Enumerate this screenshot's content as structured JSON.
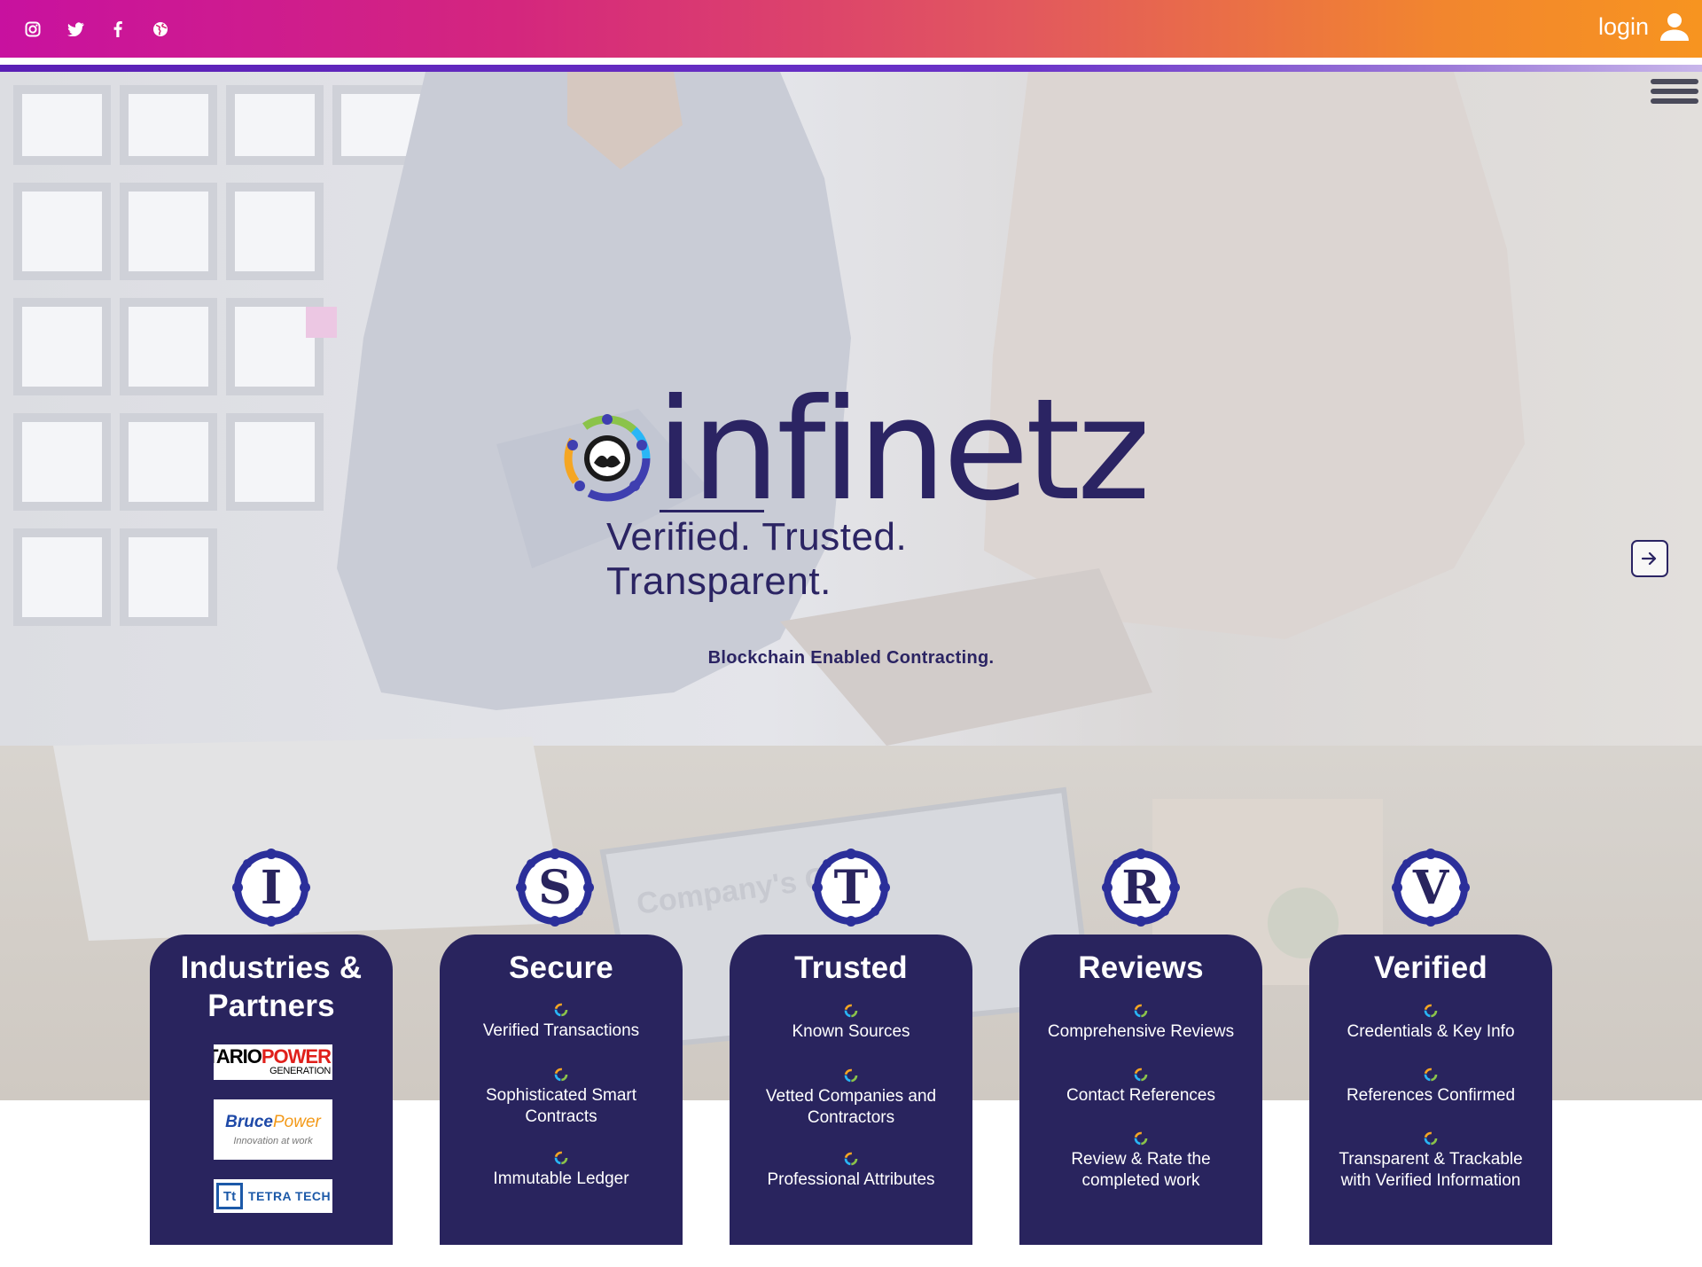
{
  "topbar": {
    "social": [
      "instagram-icon",
      "twitter-icon",
      "facebook-icon",
      "globe-icon"
    ],
    "login_label": "login"
  },
  "hero": {
    "brand_name": "infinetz",
    "tagline": "Verified. Trusted. Transparent.",
    "subtagline": "Blockchain Enabled Contracting."
  },
  "cards": [
    {
      "letter": "I",
      "title_line1": "Industries &",
      "title_line2": "Partners",
      "partners": [
        {
          "name_a": "ONTARIO",
          "name_b": "POWER",
          "name_c": "GENERATION"
        },
        {
          "name_a": "Bruce",
          "name_b": "Power",
          "name_c": "Innovation at work"
        },
        {
          "name_a": "Tt",
          "name_b": "TETRA TECH"
        }
      ]
    },
    {
      "letter": "S",
      "title": "Secure",
      "items": [
        {
          "line1": "Verified Transactions",
          "line2": ""
        },
        {
          "line1": "Sophisticated Smart",
          "line2": "Contracts"
        },
        {
          "line1": "Immutable Ledger",
          "line2": ""
        }
      ]
    },
    {
      "letter": "T",
      "title": "Trusted",
      "items": [
        {
          "line1": "Known Sources",
          "line2": ""
        },
        {
          "line1": "Vetted Companies and",
          "line2": "Contractors"
        },
        {
          "line1": "Professional Attributes",
          "line2": ""
        }
      ]
    },
    {
      "letter": "R",
      "title": "Reviews",
      "items": [
        {
          "line1": "Comprehensive Reviews",
          "line2": ""
        },
        {
          "line1": "Contact References",
          "line2": ""
        },
        {
          "line1": "Review & Rate the",
          "line2": "completed work"
        }
      ]
    },
    {
      "letter": "V",
      "title": "Verified",
      "items": [
        {
          "line1": "Credentials & Key Info",
          "line2": ""
        },
        {
          "line1": "References Confirmed",
          "line2": ""
        },
        {
          "line1": "Transparent & Trackable",
          "line2": "with Verified Information"
        }
      ]
    }
  ],
  "colors": {
    "navy": "#29245e",
    "gradient_start": "#c8119f",
    "gradient_end": "#f79420",
    "accent_line": "#5a1fb5"
  }
}
